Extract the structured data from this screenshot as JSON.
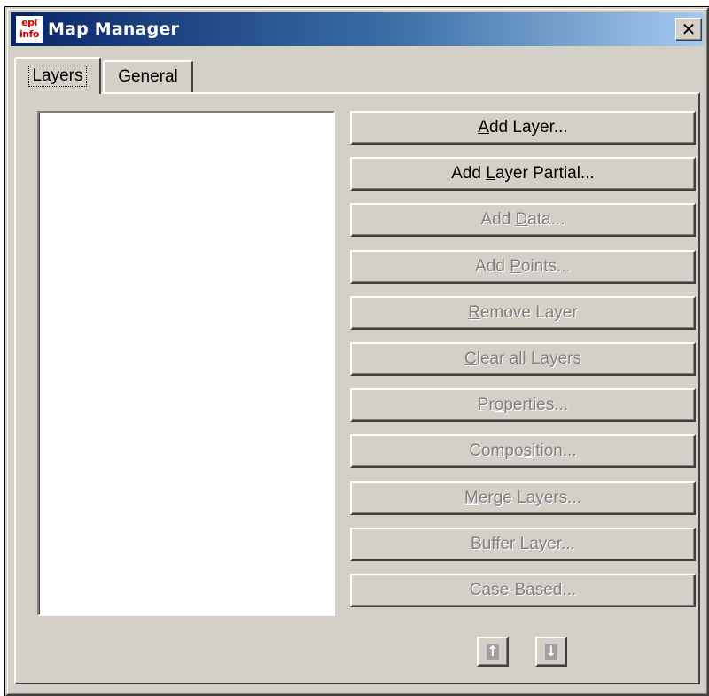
{
  "window": {
    "title": "Map Manager",
    "icon_top": "epi",
    "icon_bottom": "info",
    "close_glyph": "✕"
  },
  "tabs": [
    {
      "label": "Layers",
      "active": true
    },
    {
      "label": "General",
      "active": false
    }
  ],
  "buttons": [
    {
      "pre": "",
      "mnemonic": "A",
      "post": "dd Layer...",
      "enabled": true
    },
    {
      "pre": "Add ",
      "mnemonic": "L",
      "post": "ayer Partial...",
      "enabled": true
    },
    {
      "pre": "Add ",
      "mnemonic": "D",
      "post": "ata...",
      "enabled": false
    },
    {
      "pre": "Add ",
      "mnemonic": "P",
      "post": "oints...",
      "enabled": false
    },
    {
      "pre": "",
      "mnemonic": "R",
      "post": "emove Layer",
      "enabled": false
    },
    {
      "pre": "",
      "mnemonic": "C",
      "post": "lear all Layers",
      "enabled": false
    },
    {
      "pre": "Pr",
      "mnemonic": "o",
      "post": "perties...",
      "enabled": false
    },
    {
      "pre": "Compo",
      "mnemonic": "s",
      "post": "ition...",
      "enabled": false
    },
    {
      "pre": "",
      "mnemonic": "M",
      "post": "erge Layers...",
      "enabled": false
    },
    {
      "pre": "Buffer Layer...",
      "mnemonic": "",
      "post": "",
      "enabled": false
    },
    {
      "pre": "Case-Based...",
      "mnemonic": "",
      "post": "",
      "enabled": false
    }
  ],
  "layer_list": {
    "items": []
  },
  "move_buttons": [
    {
      "icon": "move-up-icon",
      "glyph": "↑"
    },
    {
      "icon": "move-down-icon",
      "glyph": "↓"
    }
  ],
  "colors": {
    "title_start": "#0a246a",
    "title_end": "#a6caf0",
    "face": "#d4d0c8",
    "disabled_text": "#808080"
  }
}
